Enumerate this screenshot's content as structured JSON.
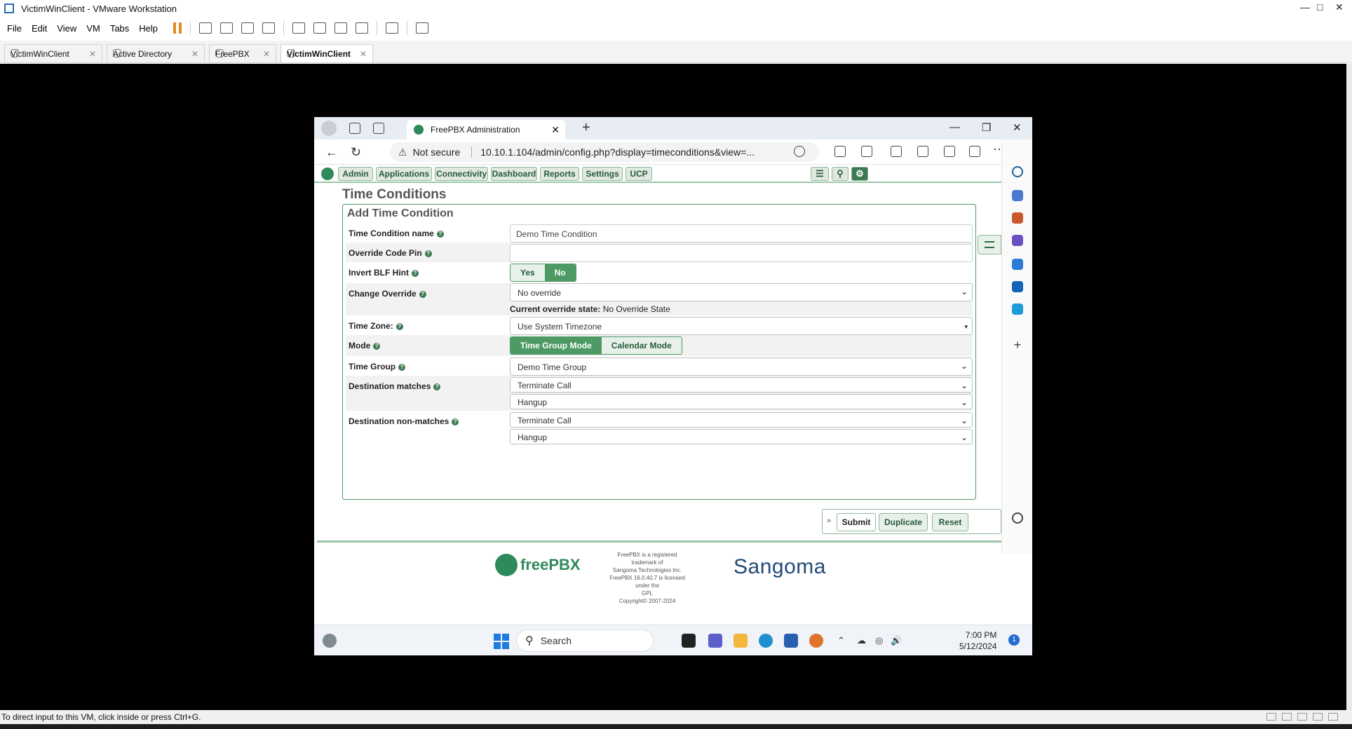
{
  "vmware": {
    "window_title": "VictimWinClient - VMware Workstation",
    "menu": [
      "File",
      "Edit",
      "View",
      "VM",
      "Tabs",
      "Help"
    ],
    "tabs": [
      {
        "label": "VictimWinClient",
        "active": false
      },
      {
        "label": "Active Directory",
        "active": false
      },
      {
        "label": "FreePBX",
        "active": false
      },
      {
        "label": "VictimWinClient",
        "active": true
      }
    ],
    "status_text": "To direct input to this VM, click inside or press Ctrl+G."
  },
  "browser": {
    "tab_title": "FreePBX Administration",
    "security": "Not secure",
    "url": "10.10.1.104/admin/config.php?display=timeconditions&view=..."
  },
  "pbx": {
    "nav": [
      "Admin",
      "Applications",
      "Connectivity",
      "Dashboard",
      "Reports",
      "Settings",
      "UCP"
    ],
    "page_title": "Time Conditions",
    "form_title": "Add Time Condition",
    "fields": {
      "name_label": "Time Condition name",
      "name_value": "Demo Time Condition",
      "pin_label": "Override Code Pin",
      "pin_value": "",
      "blf_label": "Invert BLF Hint",
      "blf_yes": "Yes",
      "blf_no": "No",
      "override_label": "Change Override",
      "override_value": "No override",
      "override_state_label": "Current override state:",
      "override_state_value": "No Override State",
      "tz_label": "Time Zone:",
      "tz_value": "Use System Timezone",
      "mode_label": "Mode",
      "mode_group": "Time Group Mode",
      "mode_calendar": "Calendar Mode",
      "tg_label": "Time Group",
      "tg_value": "Demo Time Group",
      "dm_label": "Destination matches",
      "dm_type": "Terminate Call",
      "dm_target": "Hangup",
      "dnm_label": "Destination non-matches",
      "dnm_type": "Terminate Call",
      "dnm_target": "Hangup"
    },
    "actions": {
      "submit": "Submit",
      "duplicate": "Duplicate",
      "reset": "Reset"
    },
    "footer": {
      "brand": "freePBX",
      "legal_1": "FreePBX is a registered trademark of",
      "legal_2": "Sangoma Technologies Inc.",
      "legal_3": "FreePBX 16.0.40.7 is licensed under the",
      "legal_4": "GPL",
      "legal_5": "Copyright© 2007-2024",
      "partner": "Sangoma"
    }
  },
  "taskbar": {
    "search": "Search",
    "time": "7:00 PM",
    "date": "5/12/2024",
    "notifications": "1"
  },
  "colors": {
    "accent_green": "#4d9a64",
    "dark_green": "#285a3a",
    "sangoma_blue": "#234b75"
  }
}
